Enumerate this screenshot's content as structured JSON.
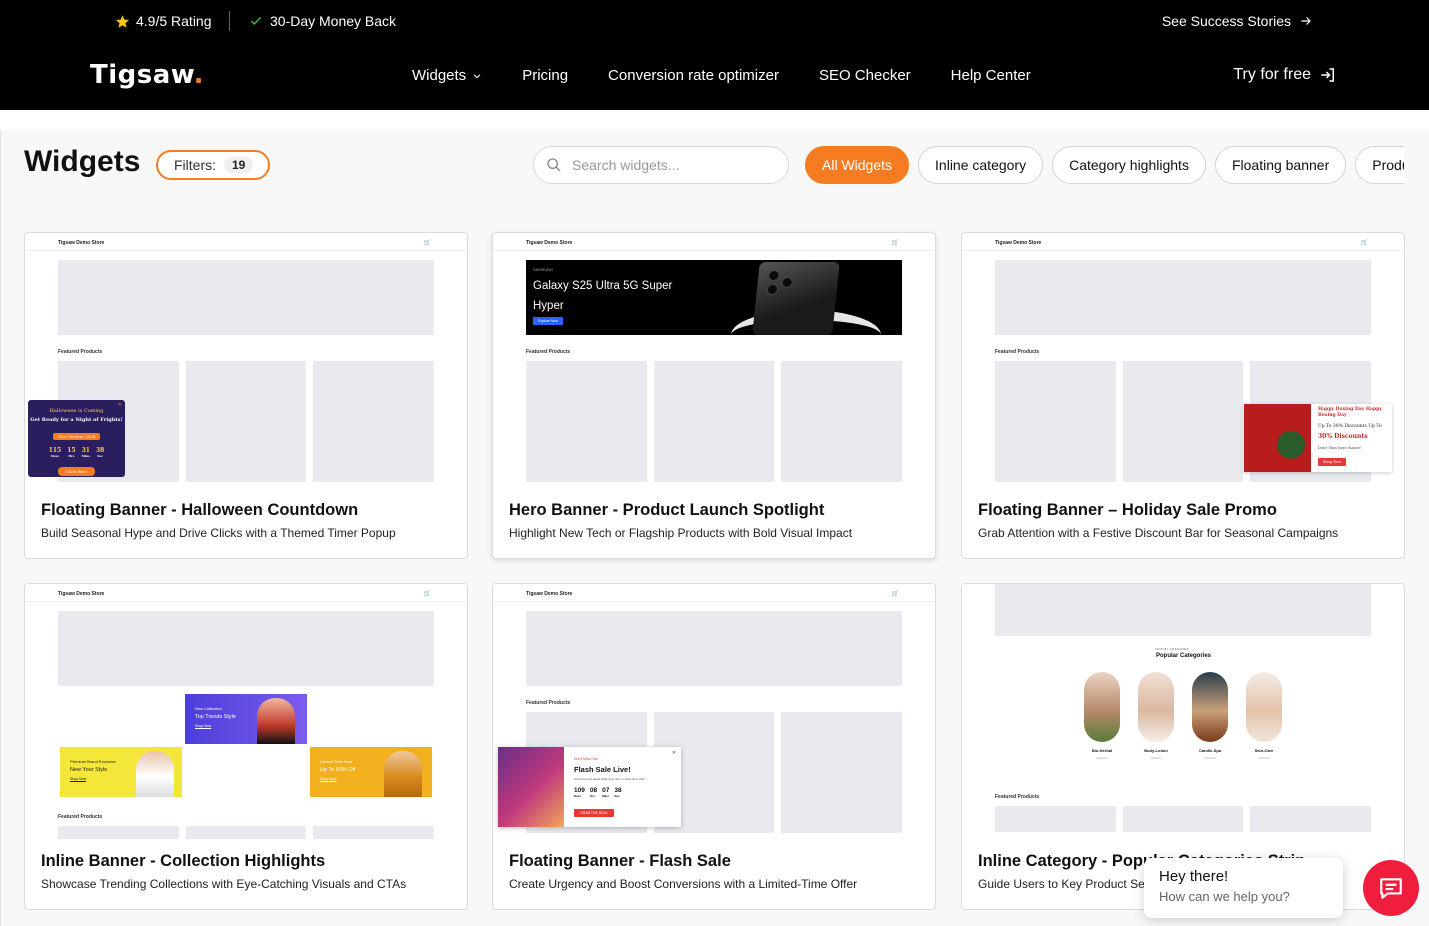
{
  "topbar": {
    "rating": "4.9/5 Rating",
    "money_back": "30-Day Money Back",
    "success": "See Success Stories"
  },
  "nav": {
    "logo": "Tigsaw",
    "logo_dot": ".",
    "links": [
      "Widgets",
      "Pricing",
      "Conversion rate optimizer",
      "SEO Checker",
      "Help Center"
    ],
    "cta": "Try for free"
  },
  "page": {
    "heading": "Widgets",
    "filters_label": "Filters:",
    "filters_count": "19",
    "search_placeholder": "Search widgets...",
    "chips": [
      "All Widgets",
      "Inline category",
      "Category highlights",
      "Floating banner",
      "Produ"
    ]
  },
  "colors": {
    "accent": "#f57c20",
    "chat": "#f01e3c"
  },
  "preview": {
    "store": "Tigsaw Demo Store",
    "featured": "Featured Products"
  },
  "cards": [
    {
      "title": "Floating Banner - Halloween Countdown",
      "desc": "Build Seasonal Hype and Drive Clicks with a Themed Timer Popup"
    },
    {
      "title": "Hero Banner - Product Launch Spotlight",
      "desc": "Highlight New Tech or Flagship Products with Bold Visual Impact"
    },
    {
      "title": "Floating Banner – Holiday Sale Promo",
      "desc": "Grab Attention with a Festive Discount Bar for Seasonal Campaigns"
    },
    {
      "title": "Inline Banner - Collection Highlights",
      "desc": "Showcase Trending Collections with Eye-Catching Visuals and CTAs"
    },
    {
      "title": "Floating Banner - Flash Sale",
      "desc": "Create Urgency and Boost Conversions with a Limited-Time Offer"
    },
    {
      "title": "Inline Category - Popular Categories Strip",
      "desc": "Guide Users to Key Product Sections"
    }
  ],
  "halloween": {
    "line1": "Halloween is Coming",
    "line2": "Get Ready for a Night of Frights!",
    "date": "31st October 2024",
    "countdown": [
      "115",
      "15",
      "31",
      "38"
    ],
    "units": [
      "Days",
      "Hrs",
      "Mins",
      "Sec"
    ],
    "cta": "Click Here"
  },
  "hero": {
    "brand": "SAMSUNG",
    "headline": "Galaxy S25 Ultra 5G Super Hyper",
    "cta": "Explore Now"
  },
  "holiday": {
    "line1": "Happy Boxing Day Happy Boxing Day",
    "line2": "Up To 30% Discounts Up To",
    "line3": "30% Discounts",
    "line4": "Don't Miss your chance!",
    "cta": "Shop Now"
  },
  "collection": {
    "b1_a": "New Collection",
    "b1_b": "Top Trends Style",
    "b1_c": "Shop Now",
    "b2_a": "Premium Brand Exclusive",
    "b2_b": "New Your Style",
    "b2_c": "Shop Now",
    "b3_a": "Limited Time Deal",
    "b3_b": "Up To 50% Off",
    "b3_c": "Shop Now"
  },
  "flash": {
    "tag": "Don't Miss Out!",
    "title": "Flash Sale Live!",
    "sub": "Grab the best deals while they last. Limited time offer!",
    "countdown": [
      "109",
      "08",
      "07",
      "38"
    ],
    "units": [
      "Days",
      "Hrs",
      "Mins",
      "Sec"
    ],
    "cta": "GRAB THE DEAL"
  },
  "categories": {
    "small": "SHOP BY CATEGORIES",
    "title": "Popular Categories",
    "items": [
      {
        "name": "Bio-Herbal",
        "sub": "10 Items"
      },
      {
        "name": "Body-Lotion",
        "sub": "8 Items"
      },
      {
        "name": "Candle-Spa",
        "sub": "12 Items"
      },
      {
        "name": "Skin-Care",
        "sub": "20 Items"
      }
    ]
  },
  "chat": {
    "title": "Hey there!",
    "subtitle": "How can we help you?"
  }
}
